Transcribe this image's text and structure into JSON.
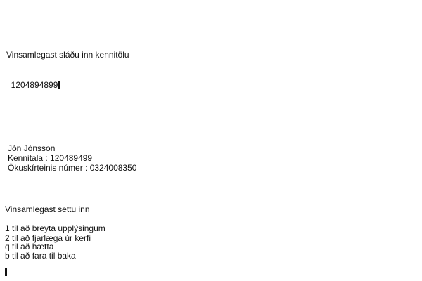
{
  "prompt": {
    "label": "Vinsamlegast sláðu inn kennitölu",
    "input_value": "1204894899"
  },
  "record": {
    "name": "Jón Jónsson",
    "kennitala_line": "Kennitala : 120489499",
    "license_line": "Ökuskírteinis númer : 0324008350"
  },
  "menu": {
    "heading": "Vinsamlegast settu inn",
    "options": [
      "1 til að breyta upplýsingum",
      "2 til að fjarlæga úr kerfi",
      "q til að hætta",
      "b til að fara til baka"
    ]
  }
}
